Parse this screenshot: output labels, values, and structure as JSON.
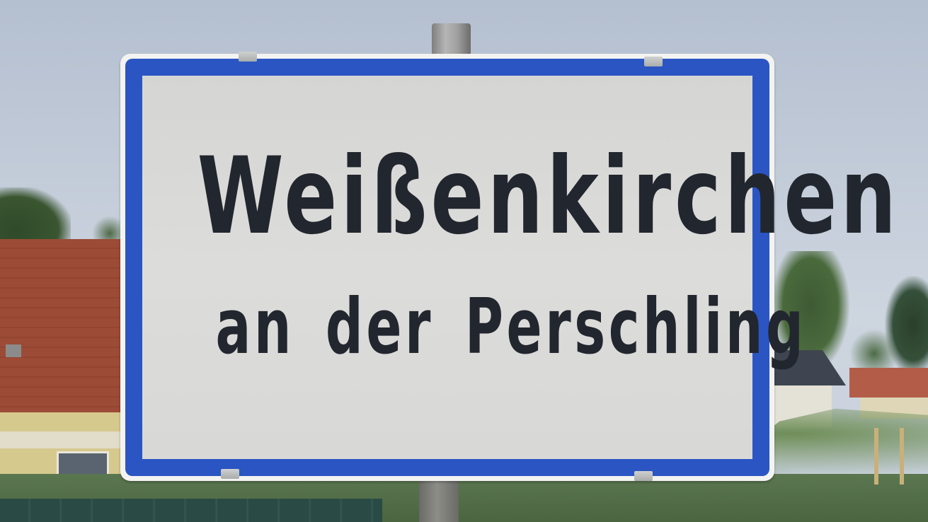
{
  "sign": {
    "town_name": "Weißenkirchen",
    "subtitle": "an der Perschling",
    "border_color": "#2a55c3",
    "background_color": "#dcdcda",
    "text_color": "#22262e"
  }
}
